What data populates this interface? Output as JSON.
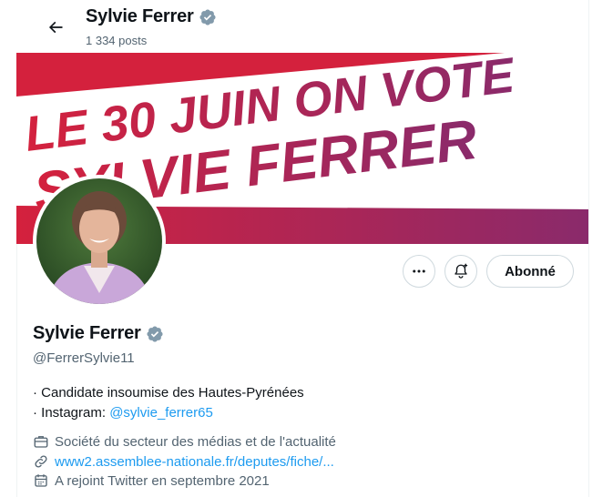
{
  "header": {
    "back_label": "←",
    "display_name": "Sylvie Ferrer",
    "posts_count": "1 334 posts"
  },
  "banner": {
    "line1": "LE 30 JUIN ON VOTE",
    "line2": "SYLVIE FERRER",
    "colors": {
      "red": "#d4213d",
      "purple": "#8a2a6b",
      "white": "#ffffff"
    }
  },
  "actions": {
    "more_label": "more-icon",
    "notify_label": "bell-plus-icon",
    "follow_label": "Abonné"
  },
  "profile": {
    "display_name": "Sylvie Ferrer",
    "handle": "@FerrerSylvie11",
    "bio_line1": "· Candidate insoumise des Hautes-Pyrénées",
    "bio_line2_prefix": "· Instagram: ",
    "bio_line2_link": "@sylvie_ferrer65",
    "category": "Société du secteur des médias et de l'actualité",
    "website": "www2.assemblee-nationale.fr/deputes/fiche/...",
    "joined": "A rejoint Twitter en septembre 2021"
  },
  "colors": {
    "text": "#0f1419",
    "secondary": "#536471",
    "link": "#1d9bf0",
    "verified_badge": "#829aab",
    "border": "#cfd9de"
  }
}
